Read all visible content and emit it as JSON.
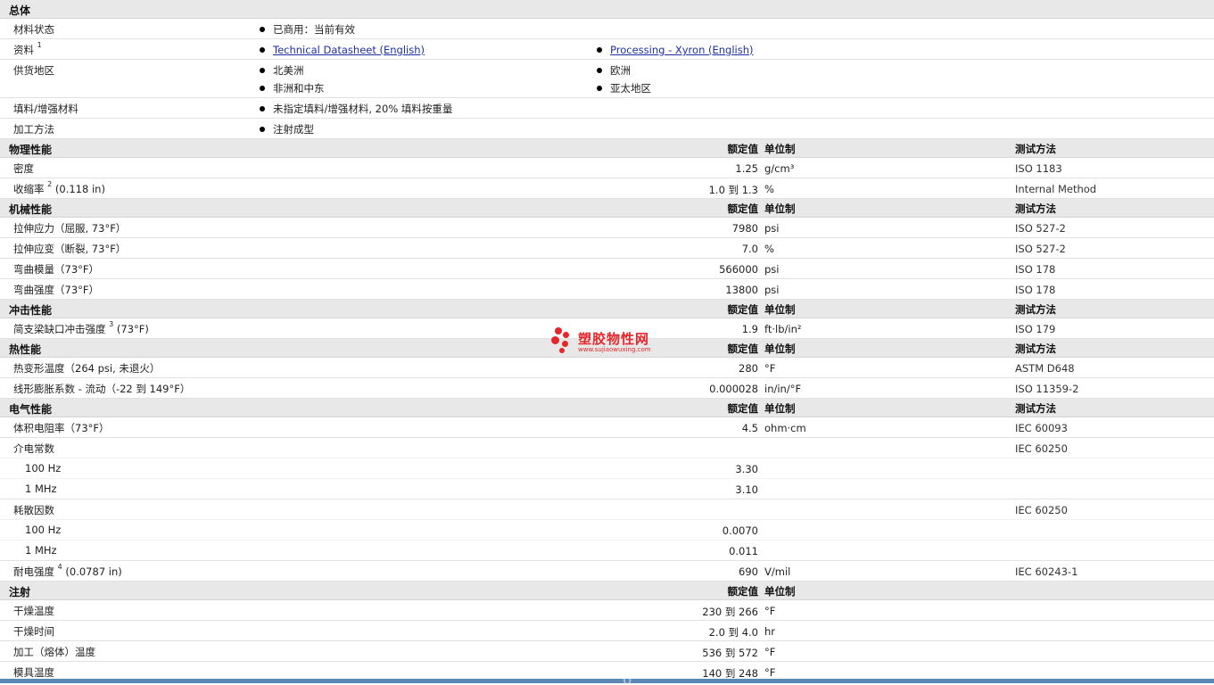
{
  "general": {
    "title": "总体",
    "material_status": {
      "label": "材料状态",
      "value": "已商用：当前有效"
    },
    "docs": {
      "label": "资料",
      "sup": "1",
      "link1": "Technical Datasheet (English)",
      "link2": "Processing - Xyron (English)"
    },
    "region": {
      "label": "供货地区",
      "items": [
        "北美洲",
        "非洲和中东",
        "欧洲",
        "亚太地区"
      ]
    },
    "filler": {
      "label": "填料/增强材料",
      "value": "未指定填料/增强材料, 20% 填料按重量"
    },
    "process": {
      "label": "加工方法",
      "value": "注射成型"
    }
  },
  "headers": {
    "nominal": "额定值",
    "unit": "单位制",
    "method": "测试方法"
  },
  "physical": {
    "title": "物理性能",
    "rows": [
      {
        "label": "密度",
        "sup": "",
        "cond": "",
        "value": "1.25",
        "unit": "g/cm³",
        "method": "ISO 1183"
      },
      {
        "label": "收缩率",
        "sup": "2",
        "cond": "(0.118 in)",
        "value": "1.0 到  1.3",
        "unit": "%",
        "method": "Internal Method"
      }
    ]
  },
  "mechanical": {
    "title": "机械性能",
    "rows": [
      {
        "label": "拉伸应力（屈服, 73°F）",
        "value": "7980",
        "unit": "psi",
        "method": "ISO 527-2"
      },
      {
        "label": "拉伸应变（断裂, 73°F）",
        "value": "7.0",
        "unit": "%",
        "method": "ISO 527-2"
      },
      {
        "label": "弯曲模量（73°F）",
        "value": "566000",
        "unit": "psi",
        "method": "ISO 178"
      },
      {
        "label": "弯曲强度（73°F）",
        "value": "13800",
        "unit": "psi",
        "method": "ISO 178"
      }
    ]
  },
  "impact": {
    "title": "冲击性能",
    "rows": [
      {
        "label": "简支梁缺口冲击强度",
        "sup": "3",
        "cond": "(73°F)",
        "value": "1.9",
        "unit": "ft·lb/in²",
        "method": "ISO 179"
      }
    ]
  },
  "thermal": {
    "title": "热性能",
    "rows": [
      {
        "label": "热变形温度（264 psi, 未退火）",
        "value": "280",
        "unit": "°F",
        "method": "ASTM D648"
      },
      {
        "label": "线形膨胀系数 - 流动（-22 到  149°F）",
        "value": "0.000028",
        "unit": "in/in/°F",
        "method": "ISO 11359-2"
      }
    ]
  },
  "electrical": {
    "title": "电气性能",
    "volume": {
      "label": "体积电阻率（73°F）",
      "value": "4.5",
      "unit": "ohm·cm",
      "method": "IEC 60093"
    },
    "dielectric": {
      "label": "介电常数",
      "method": "IEC 60250",
      "sub": [
        {
          "label": "100 Hz",
          "value": "3.30"
        },
        {
          "label": "1 MHz",
          "value": "3.10"
        }
      ]
    },
    "dissipation": {
      "label": "耗散因数",
      "method": "IEC 60250",
      "sub": [
        {
          "label": "100 Hz",
          "value": "0.0070"
        },
        {
          "label": "1 MHz",
          "value": "0.011"
        }
      ]
    },
    "strength": {
      "label": "耐电强度",
      "sup": "4",
      "cond": "(0.0787 in)",
      "value": "690",
      "unit": "V/mil",
      "method": "IEC 60243-1"
    }
  },
  "injection": {
    "title": "注射",
    "rows": [
      {
        "label": "干燥温度",
        "value": "230 到  266",
        "unit": "°F"
      },
      {
        "label": "干燥时间",
        "value": "2.0 到  4.0",
        "unit": "hr"
      },
      {
        "label": "加工（熔体）温度",
        "value": "536 到  572",
        "unit": "°F"
      },
      {
        "label": "模具温度",
        "value": "140 到  248",
        "unit": "°F"
      }
    ]
  },
  "watermark": {
    "cn": "塑胶物性网",
    "en": "www.sujiaowuxing.com",
    "color": "#e8252a"
  },
  "bottom": {
    "glyph": "《 》"
  }
}
